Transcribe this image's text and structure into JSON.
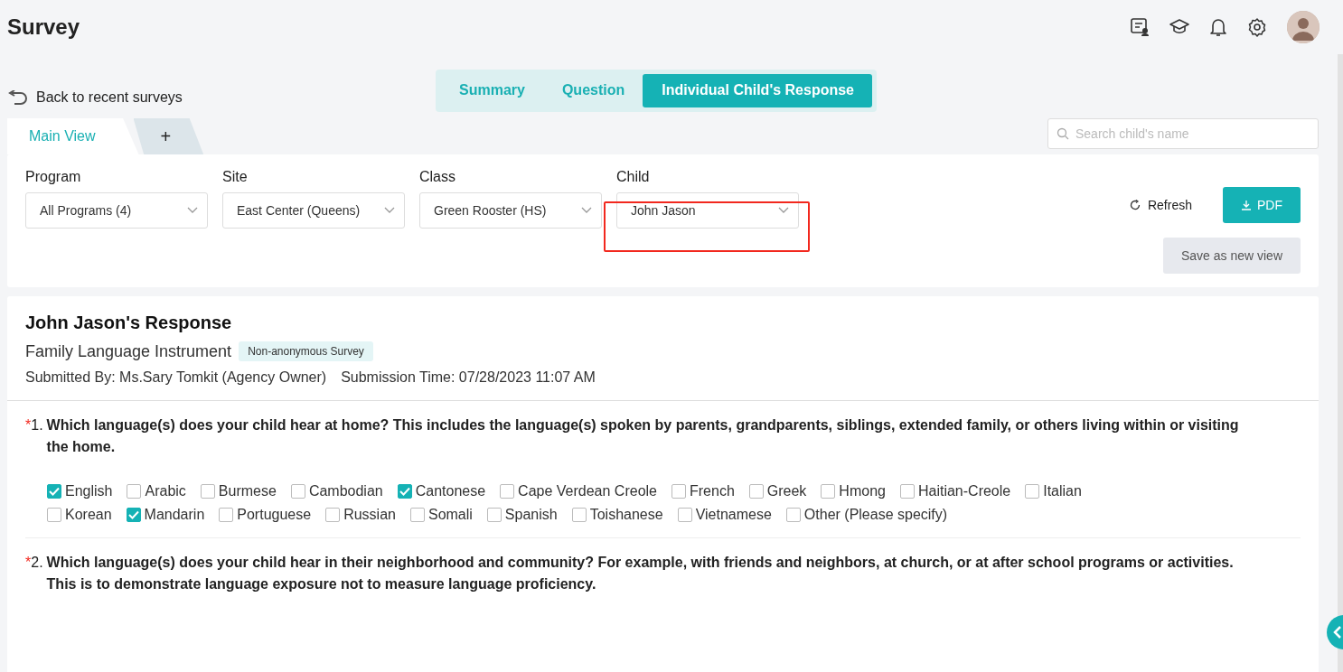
{
  "header": {
    "title": "Survey"
  },
  "back_link": "Back to recent surveys",
  "view_tabs": [
    {
      "label": "Summary",
      "selected": false
    },
    {
      "label": "Question",
      "selected": false
    },
    {
      "label": "Individual Child's Response",
      "selected": true
    }
  ],
  "sheet_tabs": [
    {
      "label": "Main View",
      "selected": true
    },
    {
      "label": "+",
      "selected": false
    }
  ],
  "search": {
    "placeholder": "Search child's name"
  },
  "filters": [
    {
      "label": "Program",
      "value": "All Programs (4)",
      "highlighted": false
    },
    {
      "label": "Site",
      "value": "East Center (Queens)",
      "highlighted": false
    },
    {
      "label": "Class",
      "value": "Green Rooster (HS)",
      "highlighted": false
    },
    {
      "label": "Child",
      "value": "John Jason",
      "highlighted": true
    }
  ],
  "actions": {
    "refresh": "Refresh",
    "pdf": "PDF",
    "save_view": "Save as new view"
  },
  "response": {
    "title": "John Jason's Response",
    "survey_name": "Family Language Instrument",
    "tag": "Non-anonymous Survey",
    "submitted_by": "Submitted By: Ms.Sary Tomkit (Agency Owner)",
    "submission_time": "Submission Time: 07/28/2023 11:07 AM"
  },
  "questions": [
    {
      "required_mark": "*",
      "number": "1.",
      "text": "Which language(s) does your child hear at home? This includes the language(s) spoken by parents, grandparents, siblings, extended family, or others living within or visiting the home.",
      "option_rows": [
        [
          {
            "label": "English",
            "checked": true
          },
          {
            "label": "Arabic",
            "checked": false
          },
          {
            "label": "Burmese",
            "checked": false
          },
          {
            "label": "Cambodian",
            "checked": false
          },
          {
            "label": "Cantonese",
            "checked": true
          },
          {
            "label": "Cape Verdean Creole",
            "checked": false
          },
          {
            "label": "French",
            "checked": false
          },
          {
            "label": "Greek",
            "checked": false
          },
          {
            "label": "Hmong",
            "checked": false
          },
          {
            "label": "Haitian-Creole",
            "checked": false
          },
          {
            "label": "Italian",
            "checked": false
          }
        ],
        [
          {
            "label": "Korean",
            "checked": false
          },
          {
            "label": "Mandarin",
            "checked": true
          },
          {
            "label": "Portuguese",
            "checked": false
          },
          {
            "label": "Russian",
            "checked": false
          },
          {
            "label": "Somali",
            "checked": false
          },
          {
            "label": "Spanish",
            "checked": false
          },
          {
            "label": "Toishanese",
            "checked": false
          },
          {
            "label": "Vietnamese",
            "checked": false
          },
          {
            "label": "Other (Please specify)",
            "checked": false
          }
        ]
      ]
    },
    {
      "required_mark": "*",
      "number": "2.",
      "text": "Which language(s) does your child hear in their neighborhood and community? For example, with friends and neighbors, at church, or at after school programs or activities. This is to demonstrate language exposure not to measure language proficiency."
    }
  ]
}
